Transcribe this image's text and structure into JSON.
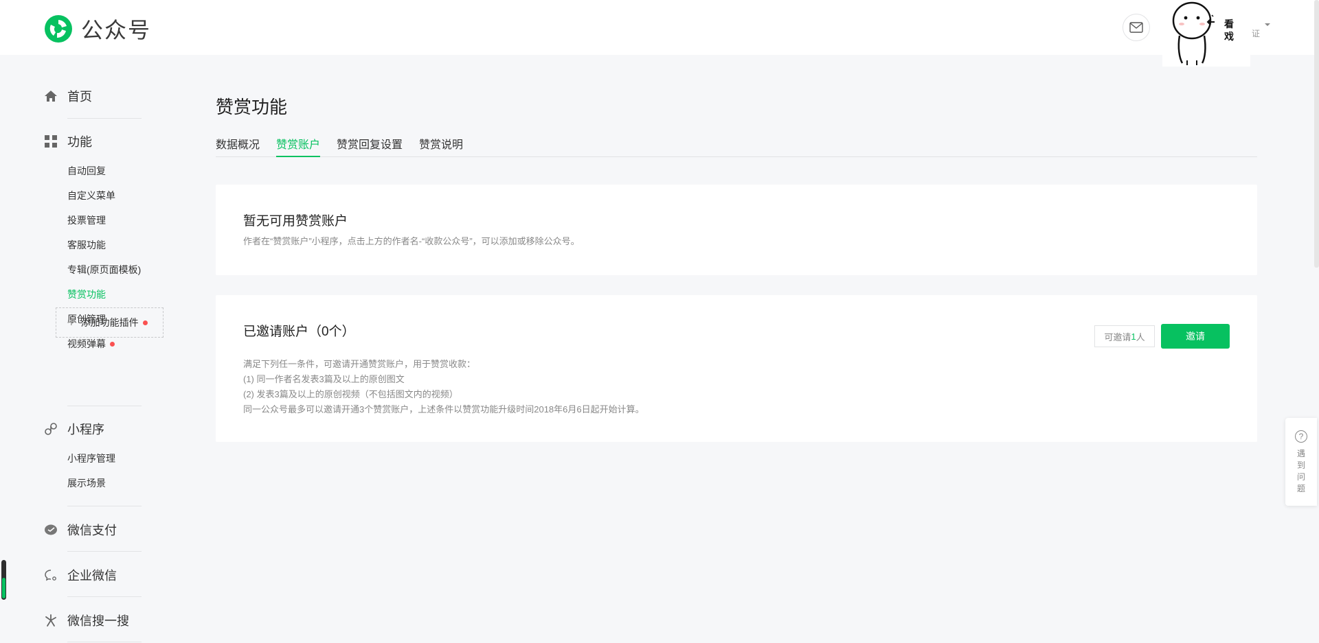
{
  "header": {
    "brand": "公众号",
    "verify_text": "证",
    "sticker_caption": "看戏"
  },
  "sidebar": {
    "home": "首页",
    "features": "功能",
    "feature_items": [
      "自动回复",
      "自定义菜单",
      "投票管理",
      "客服功能",
      "专辑(原页面模板)",
      "赞赏功能",
      "原创管理",
      "视频弹幕"
    ],
    "add_plugin": "添加功能插件",
    "miniprogram": "小程序",
    "miniprogram_items": [
      "小程序管理",
      "展示场景"
    ],
    "wechat_pay": "微信支付",
    "work_wechat": "企业微信",
    "wechat_search": "微信搜一搜"
  },
  "main": {
    "title": "赞赏功能",
    "tabs": [
      "数据概况",
      "赞赏账户",
      "赞赏回复设置",
      "赞赏说明"
    ],
    "active_tab": "赞赏账户",
    "card1": {
      "title": "暂无可用赞赏账户",
      "desc": "作者在“赞赏账户”小程序，点击上方的作者名-“收款公众号”，可以添加或移除公众号。"
    },
    "card2": {
      "title": "已邀请账户（0个）",
      "quota_prefix": "可邀请",
      "quota_num": "1",
      "quota_suffix": "人",
      "invite_button": "邀请",
      "conditions": [
        "满足下列任一条件，可邀请开通赞赏账户，用于赞赏收款：",
        "(1) 同一作者名发表3篇及以上的原创图文",
        "(2) 发表3篇及以上的原创视频（不包括图文内的视频）",
        "同一公众号最多可以邀请开通3个赞赏账户，上述条件以赞赏功能升级时间2018年6月6日起开始计算。"
      ]
    }
  },
  "help": {
    "text": "遇到问题"
  },
  "colors": {
    "accent": "#07c160",
    "badge": "#fa5151"
  }
}
